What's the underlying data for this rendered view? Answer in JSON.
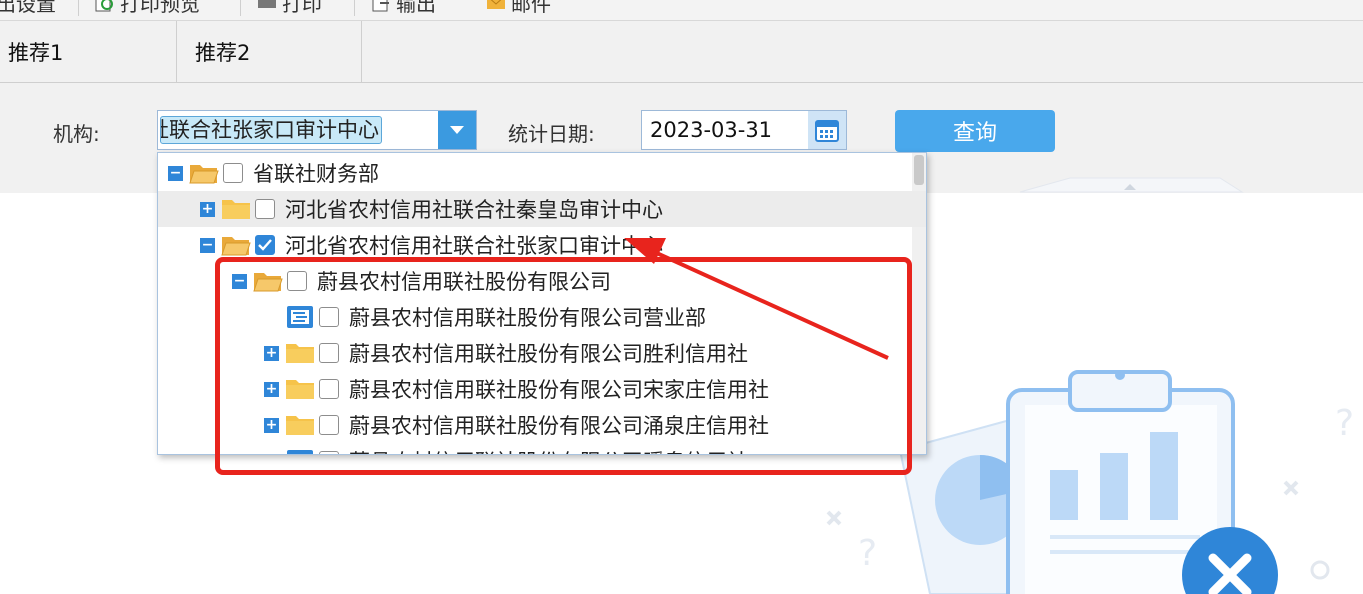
{
  "toolbar": {
    "items": [
      {
        "label": "出设置",
        "icon": "settings-icon"
      },
      {
        "label": "打印预览",
        "icon": "print-preview-icon"
      },
      {
        "label": "打印",
        "icon": "printer-icon"
      },
      {
        "label": "输出",
        "icon": "export-icon"
      },
      {
        "label": "邮件",
        "icon": "mail-icon"
      }
    ]
  },
  "tabs": [
    {
      "label": "推荐1"
    },
    {
      "label": "推荐2"
    }
  ],
  "filter": {
    "org_label": "机构:",
    "org_value": "河北省农村信用社联合社张家口审计中心",
    "date_label": "统计日期:",
    "date_value": "2023-03-31",
    "query_label": "查询"
  },
  "tree": {
    "rows": [
      {
        "label": "省联社财务部",
        "indent": 0,
        "expander": "minus",
        "icon": "folder-open",
        "checked": false
      },
      {
        "label": "河北省农村信用社联合社秦皇岛审计中心",
        "indent": 1,
        "expander": "plus",
        "icon": "folder",
        "checked": false
      },
      {
        "label": "河北省农村信用社联合社张家口审计中心",
        "indent": 1,
        "expander": "minus",
        "icon": "folder-open",
        "checked": true
      },
      {
        "label": "蔚县农村信用联社股份有限公司",
        "indent": 2,
        "expander": "minus",
        "icon": "folder-open",
        "checked": false
      },
      {
        "label": "蔚县农村信用联社股份有限公司营业部",
        "indent": 3,
        "expander": "none",
        "icon": "leaf",
        "checked": false
      },
      {
        "label": "蔚县农村信用联社股份有限公司胜利信用社",
        "indent": 3,
        "expander": "plus",
        "icon": "folder",
        "checked": false
      },
      {
        "label": "蔚县农村信用联社股份有限公司宋家庄信用社",
        "indent": 3,
        "expander": "plus",
        "icon": "folder",
        "checked": false
      },
      {
        "label": "蔚县农村信用联社股份有限公司涌泉庄信用社",
        "indent": 3,
        "expander": "plus",
        "icon": "folder",
        "checked": false
      },
      {
        "label": "蔚县农村信用联社股份有限公司暖泉信用社",
        "indent": 3,
        "expander": "none",
        "icon": "leaf",
        "checked": false
      }
    ]
  },
  "colors": {
    "accent": "#3b9ae0",
    "annotation": "#e8241d",
    "folder": "#f6c34a"
  }
}
